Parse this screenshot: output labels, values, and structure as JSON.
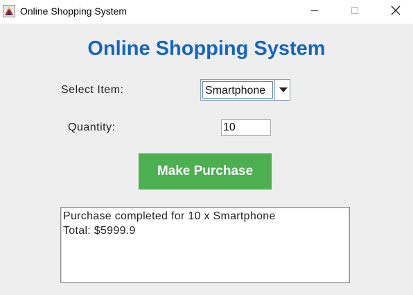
{
  "window": {
    "title": "Online Shopping System",
    "icon": "java-app-icon",
    "controls": {
      "minimize_icon": "minimize-icon",
      "maximize_icon": "maximize-icon",
      "close_icon": "close-icon"
    }
  },
  "main": {
    "heading": "Online Shopping System",
    "heading_color": "#1565c0",
    "select_item": {
      "label": "Select Item:",
      "selected": "Smartphone",
      "arrow_icon": "chevron-down-icon"
    },
    "quantity": {
      "label": "Quantity:",
      "value": "10"
    },
    "purchase_button": {
      "label": "Make Purchase",
      "color": "#4caf50"
    },
    "output": {
      "lines": [
        "Purchase completed for 10 x Smartphone",
        "Total: $5999.9"
      ]
    }
  }
}
